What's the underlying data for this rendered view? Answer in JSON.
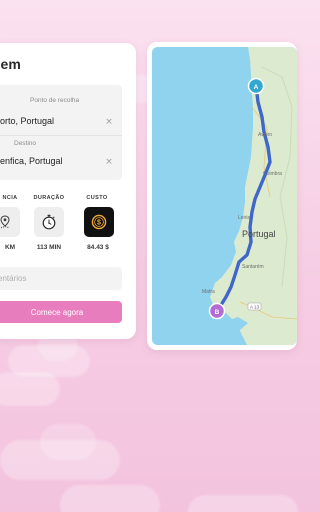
{
  "trip_card": {
    "title": "gem",
    "pickup_label": "Ponto de recolha",
    "pickup_value": "orto, Portugal",
    "destination_label": "Destino",
    "destination_value": "enfica, Portugal",
    "clear_symbol": "×",
    "stats": [
      {
        "header": "NCIA",
        "value": "KM",
        "icon": "route-pin-icon"
      },
      {
        "header": "DURAÇÃO",
        "value": "113 MIN",
        "icon": "stopwatch-icon"
      },
      {
        "header": "CUSTO",
        "value": "84.43 $",
        "icon": "coin-icon"
      }
    ],
    "comments_placeholder": "entários",
    "start_button": "Comece agora"
  },
  "map": {
    "country_label": "Portugal",
    "start_marker": "A",
    "end_marker": "B",
    "place_labels": [
      "Aveiro",
      "Coimbra",
      "Leiria",
      "Santarém",
      "Mafra",
      "A 13"
    ],
    "colors": {
      "route": "#3f66c9",
      "marker_a": "#32a8cf",
      "marker_b": "#b36bd6",
      "sea": "#8fd3ef",
      "land": "#dcebcf"
    }
  },
  "colors": {
    "accent": "#e87dbe",
    "background": "#f6cde4"
  }
}
